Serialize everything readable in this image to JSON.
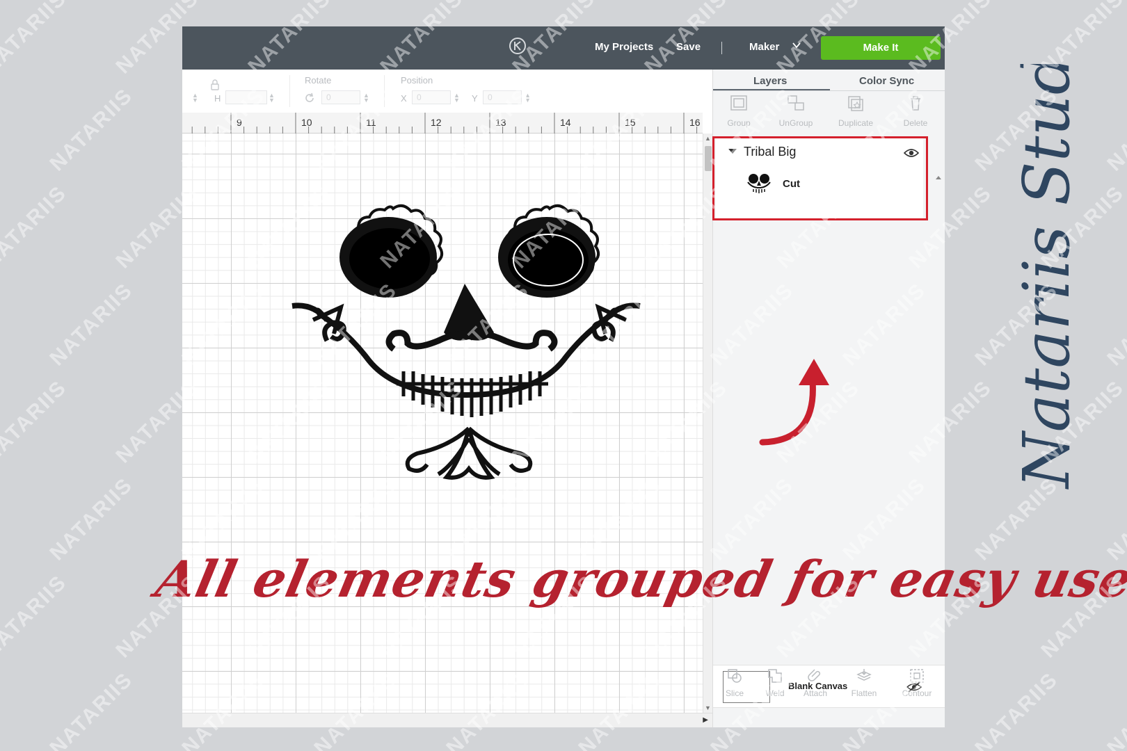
{
  "topbar": {
    "my_projects": "My Projects",
    "save": "Save",
    "machine": "Maker",
    "make_it": "Make It"
  },
  "toolbar": {
    "height_label": "H",
    "rotate_label": "Rotate",
    "position_label": "Position",
    "x_label": "X",
    "y_label": "Y",
    "rotate_value": "0",
    "x_value": "0",
    "y_value": "0"
  },
  "ruler": {
    "numbers": [
      "9",
      "10",
      "11",
      "12",
      "13",
      "14",
      "15",
      "16"
    ]
  },
  "panel": {
    "tabs": [
      {
        "label": "Layers",
        "active": true
      },
      {
        "label": "Color Sync",
        "active": false
      }
    ],
    "tools": [
      "Group",
      "UnGroup",
      "Duplicate",
      "Delete"
    ],
    "layer": {
      "title": "Tribal Big",
      "operation": "Cut"
    },
    "blank_canvas": "Blank Canvas",
    "bottom_tools": [
      "Slice",
      "Weld",
      "Attach",
      "Flatten",
      "Contour"
    ]
  },
  "annotation": {
    "caption": "All elements grouped for easy use",
    "signature": "Natariis Studio",
    "watermark": "NATARIIS"
  },
  "colors": {
    "topbar": "#4c555d",
    "make_it": "#5bbb1f",
    "highlight": "#d4202c",
    "caption": "#b5222f",
    "signature": "#2f4660"
  }
}
